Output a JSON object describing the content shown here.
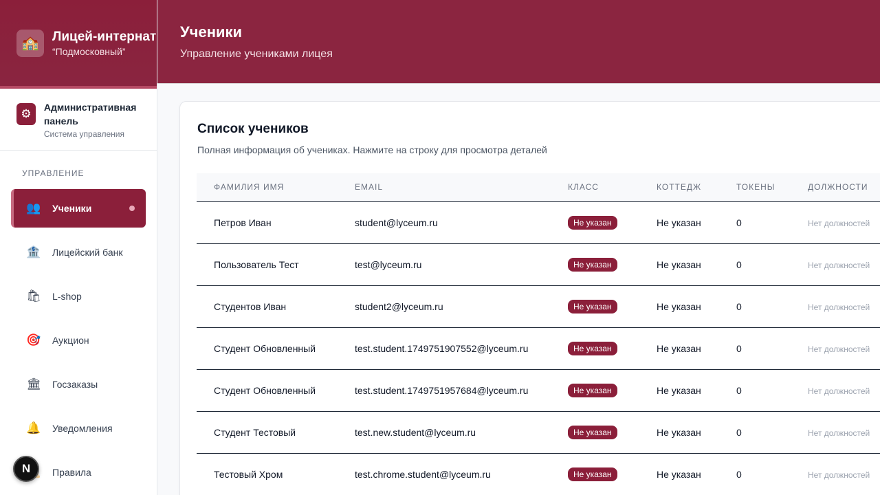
{
  "brand": {
    "logo": "school-icon",
    "title": "Лицей-интернат",
    "subtitle": "“Подмосковный”"
  },
  "admin": {
    "title": "Административная панель",
    "subtitle": "Система управления"
  },
  "sidebar": {
    "section_label": "УПРАВЛЕНИЕ",
    "items": [
      {
        "label": "Ученики",
        "icon": "👥"
      },
      {
        "label": "Лицейский банк",
        "icon": "🏦"
      },
      {
        "label": "L-shop",
        "icon": "🛍"
      },
      {
        "label": "Аукцион",
        "icon": "🎯"
      },
      {
        "label": "Госзаказы",
        "icon": "🏛"
      },
      {
        "label": "Уведомления",
        "icon": "🔔"
      },
      {
        "label": "Правила",
        "icon": "📜"
      }
    ]
  },
  "header": {
    "title": "Ученики",
    "subtitle": "Управление учениками лицея"
  },
  "card": {
    "title": "Список учеников",
    "description": "Полная информация об учениках. Нажмите на строку для просмотра деталей"
  },
  "table": {
    "columns": [
      "ФАМИЛИЯ ИМЯ",
      "EMAIL",
      "КЛАСС",
      "КОТТЕДЖ",
      "ТОКЕНЫ",
      "ДОЛЖНОСТИ"
    ],
    "rows": [
      {
        "name": "Петров Иван",
        "email": "student@lyceum.ru",
        "class": "Не указан",
        "cottage": "Не указан",
        "tokens": "0",
        "positions": "Нет должностей"
      },
      {
        "name": "Пользователь Тест",
        "email": "test@lyceum.ru",
        "class": "Не указан",
        "cottage": "Не указан",
        "tokens": "0",
        "positions": "Нет должностей"
      },
      {
        "name": "Студентов Иван",
        "email": "student2@lyceum.ru",
        "class": "Не указан",
        "cottage": "Не указан",
        "tokens": "0",
        "positions": "Нет должностей"
      },
      {
        "name": "Студент Обновленный",
        "email": "test.student.1749751907552@lyceum.ru",
        "class": "Не указан",
        "cottage": "Не указан",
        "tokens": "0",
        "positions": "Нет должностей"
      },
      {
        "name": "Студент Обновленный",
        "email": "test.student.1749751957684@lyceum.ru",
        "class": "Не указан",
        "cottage": "Не указан",
        "tokens": "0",
        "positions": "Нет должностей"
      },
      {
        "name": "Студент Тестовый",
        "email": "test.new.student@lyceum.ru",
        "class": "Не указан",
        "cottage": "Не указан",
        "tokens": "0",
        "positions": "Нет должностей"
      },
      {
        "name": "Тестовый Хром",
        "email": "test.chrome.student@lyceum.ru",
        "class": "Не указан",
        "cottage": "Не указан",
        "tokens": "0",
        "positions": "Нет должностей"
      }
    ]
  },
  "dev_badge": {
    "label": "N"
  },
  "colors": {
    "brand": "#8b1f3a",
    "header": "#8b2540"
  }
}
